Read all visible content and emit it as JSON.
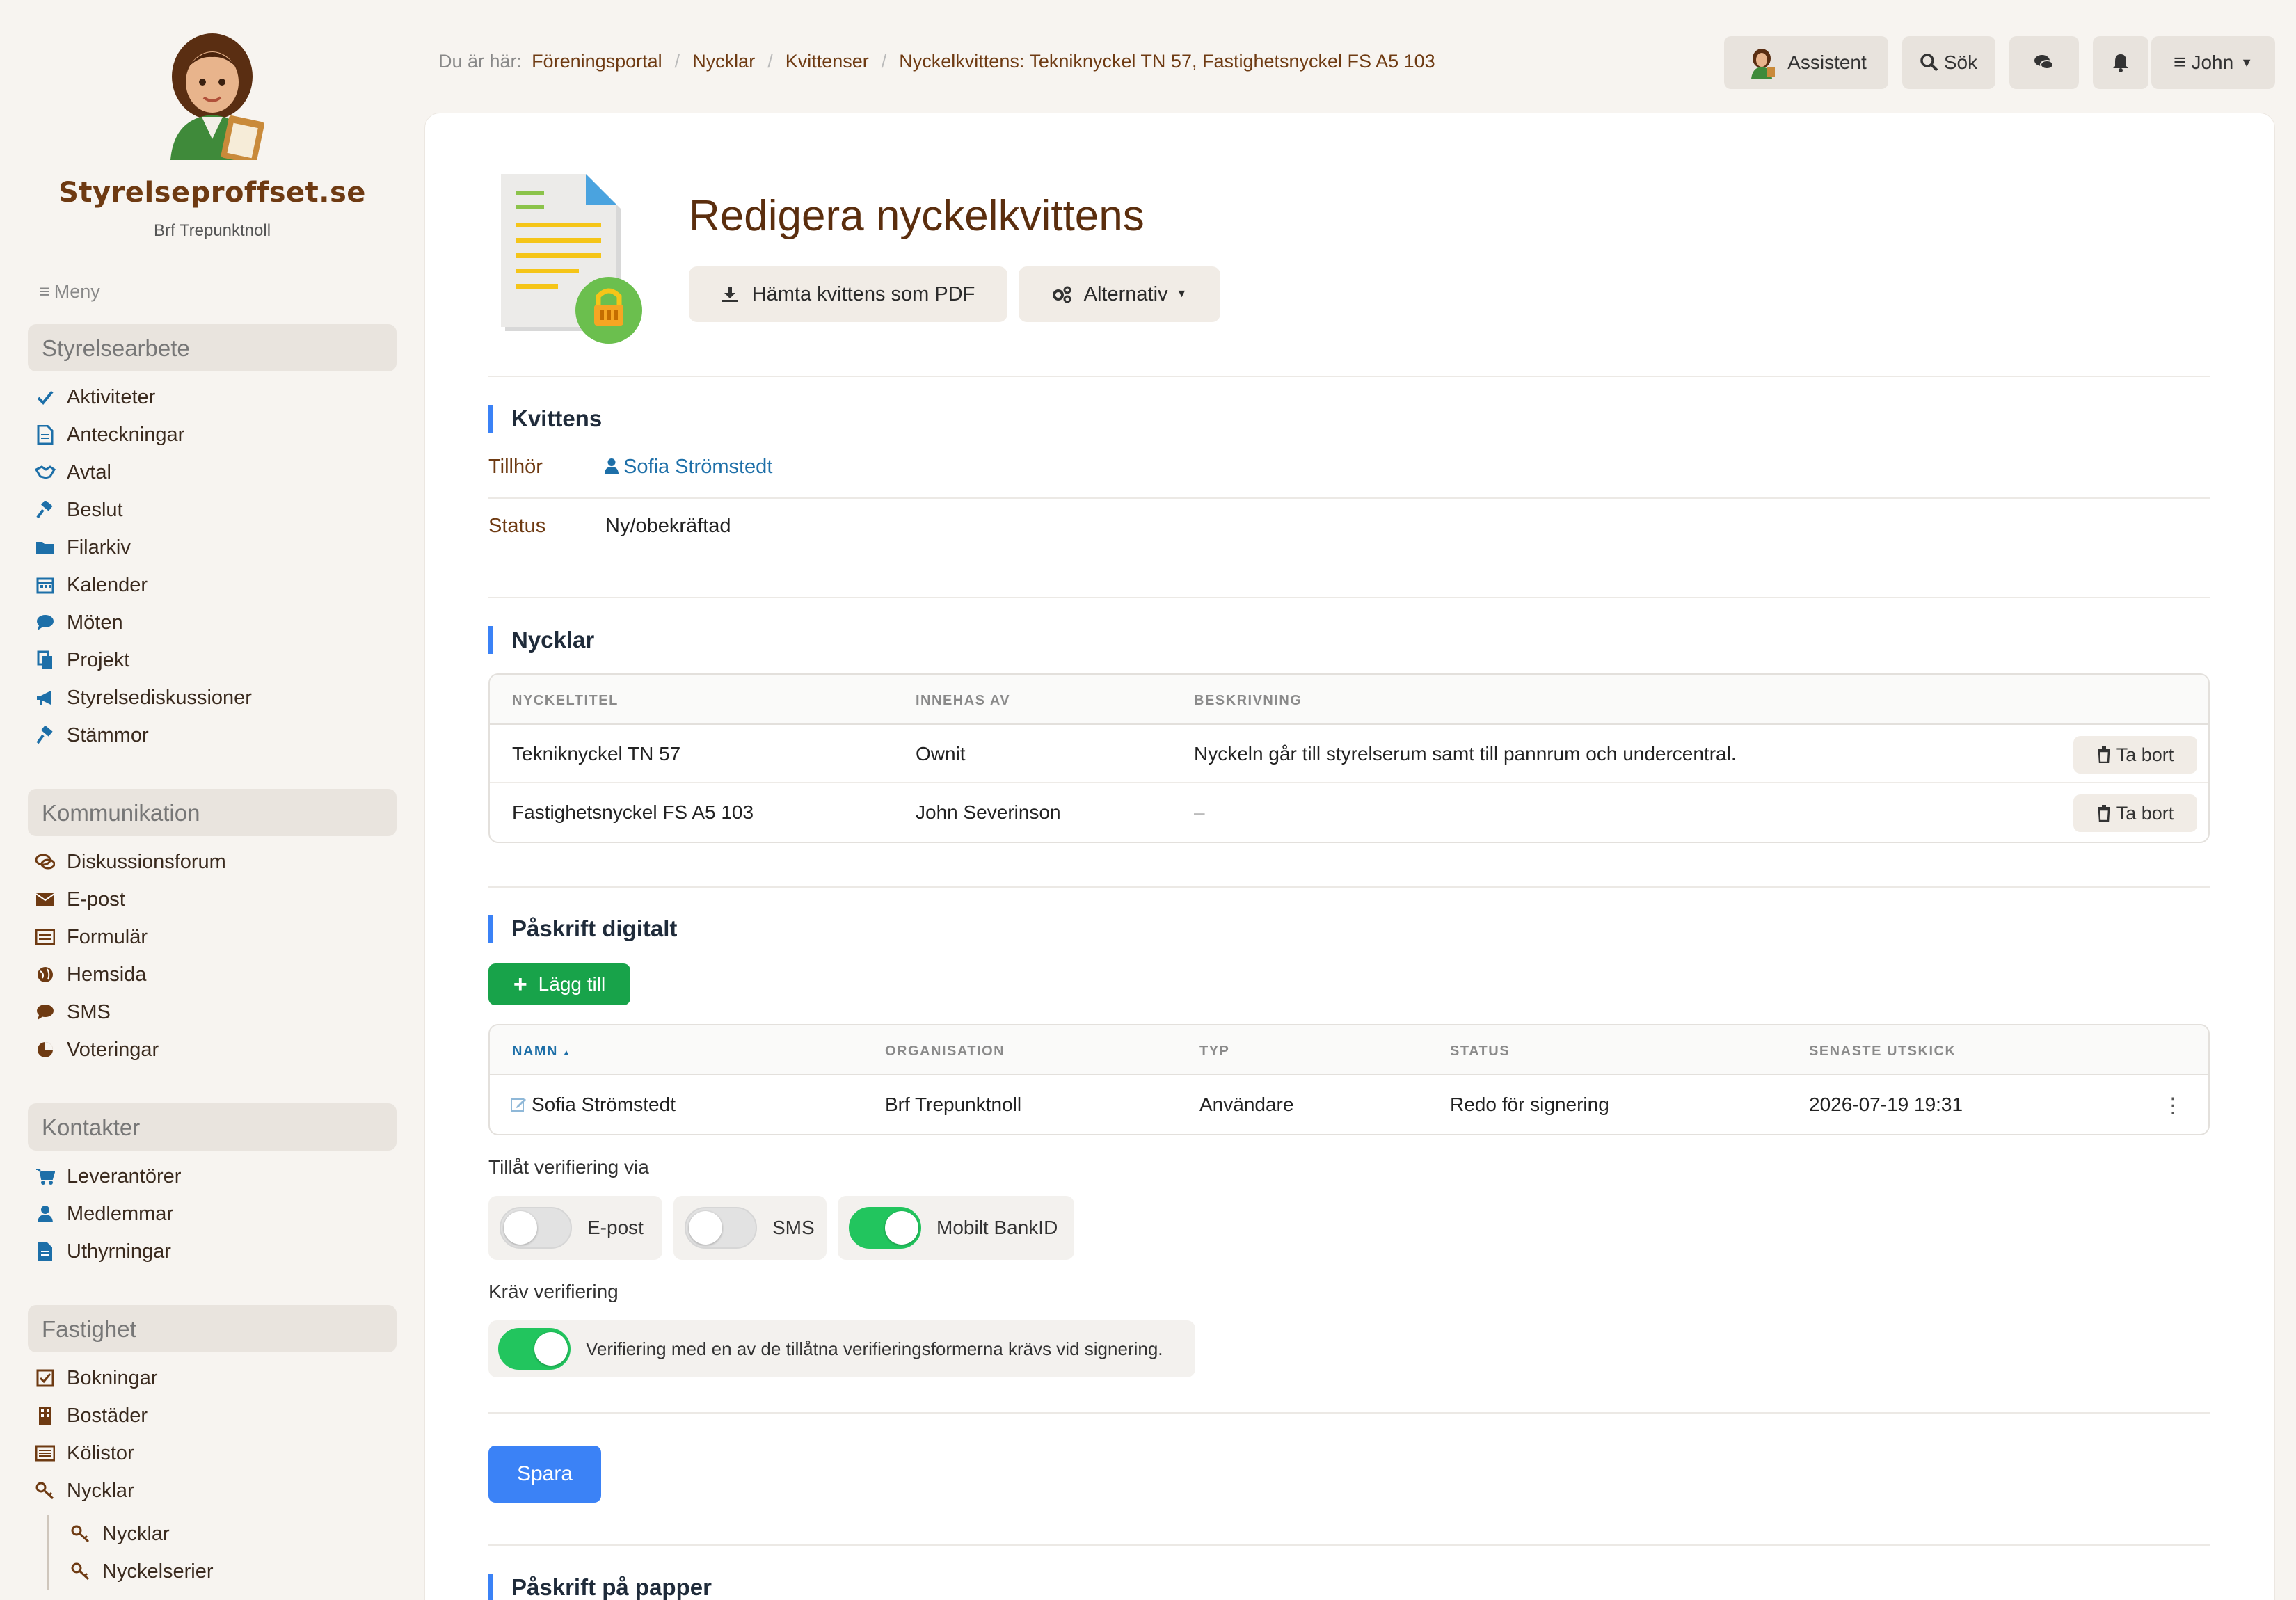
{
  "brand": {
    "title": "Styrelseproffset.se",
    "subtitle": "Brf Trepunktnoll"
  },
  "menu_label": "Meny",
  "sidebar": {
    "sections": [
      {
        "title": "Styrelsearbete",
        "items": [
          {
            "label": "Aktiviteter",
            "icon": "check-icon"
          },
          {
            "label": "Anteckningar",
            "icon": "file-icon"
          },
          {
            "label": "Avtal",
            "icon": "handshake-icon"
          },
          {
            "label": "Beslut",
            "icon": "gavel-icon"
          },
          {
            "label": "Filarkiv",
            "icon": "folder-icon"
          },
          {
            "label": "Kalender",
            "icon": "calendar-icon"
          },
          {
            "label": "Möten",
            "icon": "chat-icon"
          },
          {
            "label": "Projekt",
            "icon": "copy-icon"
          },
          {
            "label": "Styrelsediskussioner",
            "icon": "megaphone-icon"
          },
          {
            "label": "Stämmor",
            "icon": "gavel-icon"
          }
        ]
      },
      {
        "title": "Kommunikation",
        "items": [
          {
            "label": "Diskussionsforum",
            "icon": "comments-icon"
          },
          {
            "label": "E-post",
            "icon": "envelope-icon"
          },
          {
            "label": "Formulär",
            "icon": "form-icon"
          },
          {
            "label": "Hemsida",
            "icon": "globe-icon"
          },
          {
            "label": "SMS",
            "icon": "chat-icon"
          },
          {
            "label": "Voteringar",
            "icon": "pie-icon"
          }
        ]
      },
      {
        "title": "Kontakter",
        "items": [
          {
            "label": "Leverantörer",
            "icon": "cart-icon"
          },
          {
            "label": "Medlemmar",
            "icon": "user-icon"
          },
          {
            "label": "Uthyrningar",
            "icon": "file-icon"
          }
        ]
      },
      {
        "title": "Fastighet",
        "items": [
          {
            "label": "Bokningar",
            "icon": "checkbox-icon"
          },
          {
            "label": "Bostäder",
            "icon": "building-icon"
          },
          {
            "label": "Kölistor",
            "icon": "list-icon"
          },
          {
            "label": "Nycklar",
            "icon": "key-icon"
          }
        ]
      }
    ],
    "subitems": [
      {
        "label": "Nycklar",
        "icon": "key-icon"
      },
      {
        "label": "Nyckelserier",
        "icon": "key-icon"
      }
    ]
  },
  "breadcrumb": {
    "prefix": "Du är här:",
    "items": [
      "Föreningsportal",
      "Nycklar",
      "Kvittenser",
      "Nyckelkvittens: Tekniknyckel TN 57, Fastighetsnyckel FS A5 103"
    ]
  },
  "topbar": {
    "assistant": "Assistent",
    "search": "Sök",
    "user": "John"
  },
  "page": {
    "title": "Redigera nyckelkvittens",
    "pdf_button": "Hämta kvittens som PDF",
    "options_button": "Alternativ"
  },
  "receipt": {
    "section_title": "Kvittens",
    "owner_label": "Tillhör",
    "owner_value": "Sofia Strömstedt",
    "status_label": "Status",
    "status_value": "Ny/obekräftad"
  },
  "keys": {
    "section_title": "Nycklar",
    "columns": [
      "NYCKELTITEL",
      "INNEHAS AV",
      "BESKRIVNING"
    ],
    "rows": [
      {
        "title": "Tekniknyckel TN 57",
        "holder": "Ownit",
        "desc": "Nyckeln går till styrelserum samt till pannrum och undercentral."
      },
      {
        "title": "Fastighetsnyckel FS A5 103",
        "holder": "John Severinson",
        "desc": "–"
      }
    ],
    "remove_label": "Ta bort"
  },
  "digital": {
    "section_title": "Påskrift digitalt",
    "add_button": "Lägg till",
    "columns": [
      "NAMN",
      "ORGANISATION",
      "TYP",
      "STATUS",
      "SENASTE UTSKICK"
    ],
    "rows": [
      {
        "name": "Sofia Strömstedt",
        "org": "Brf Trepunktnoll",
        "type": "Användare",
        "status": "Redo för signering",
        "sent": "2026-07-19 19:31"
      }
    ],
    "verify_via_label": "Tillåt verifiering via",
    "toggles": [
      {
        "label": "E-post",
        "on": false
      },
      {
        "label": "SMS",
        "on": false
      },
      {
        "label": "Mobilt BankID",
        "on": true
      }
    ],
    "require_label": "Kräv verifiering",
    "require_toggle": {
      "label": "Verifiering med en av de tillåtna verifieringsformerna krävs vid signering.",
      "on": true
    }
  },
  "save_button": "Spara",
  "paper": {
    "section_title": "Påskrift på papper"
  },
  "colors": {
    "accent": "#3b82f6",
    "brand": "#6e3a12",
    "success": "#18a34a",
    "link": "#1d6fa8"
  }
}
